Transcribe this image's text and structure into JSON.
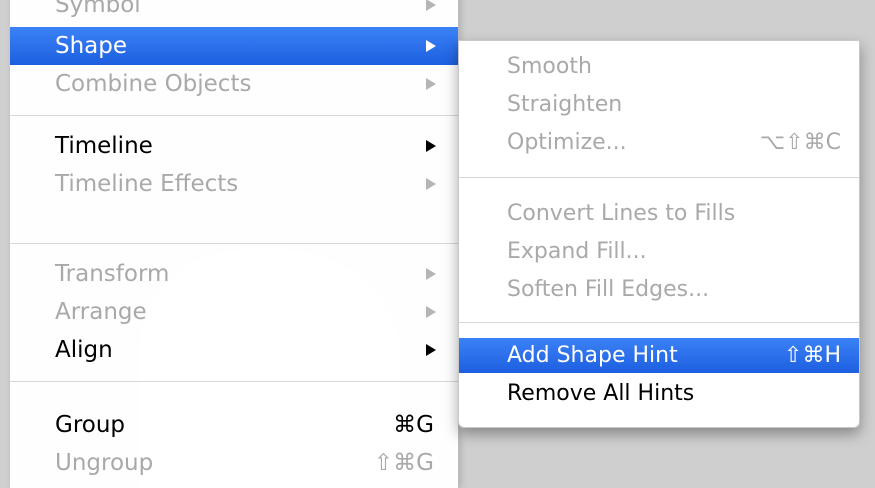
{
  "main_menu": {
    "items": [
      {
        "label": "Symbol",
        "enabled": false,
        "submenu": true
      },
      {
        "label": "Shape",
        "enabled": true,
        "selected": true,
        "submenu": true
      },
      {
        "label": "Combine Objects",
        "enabled": false,
        "submenu": true
      },
      {
        "label": "Timeline",
        "enabled": true,
        "submenu": true
      },
      {
        "label": "Timeline Effects",
        "enabled": false,
        "submenu": true
      },
      {
        "label": "Transform",
        "enabled": false,
        "submenu": true
      },
      {
        "label": "Arrange",
        "enabled": false,
        "submenu": true
      },
      {
        "label": "Align",
        "enabled": true,
        "submenu": true
      },
      {
        "label": "Group",
        "enabled": true,
        "shortcut": "⌘G"
      },
      {
        "label": "Ungroup",
        "enabled": false,
        "shortcut": "⇧⌘G"
      }
    ]
  },
  "shape_submenu": {
    "items": [
      {
        "label": "Smooth",
        "enabled": false
      },
      {
        "label": "Straighten",
        "enabled": false
      },
      {
        "label": "Optimize...",
        "enabled": false,
        "shortcut": "⌥⇧⌘C"
      },
      {
        "label": "Convert Lines to Fills",
        "enabled": false
      },
      {
        "label": "Expand Fill...",
        "enabled": false
      },
      {
        "label": "Soften Fill Edges...",
        "enabled": false
      },
      {
        "label": "Add Shape Hint",
        "enabled": true,
        "selected": true,
        "shortcut": "⇧⌘H"
      },
      {
        "label": "Remove All Hints",
        "enabled": true
      }
    ]
  },
  "colors": {
    "selection": "#2f6fe8",
    "disabled_text": "#a9a9a9",
    "enabled_text": "#000000"
  }
}
